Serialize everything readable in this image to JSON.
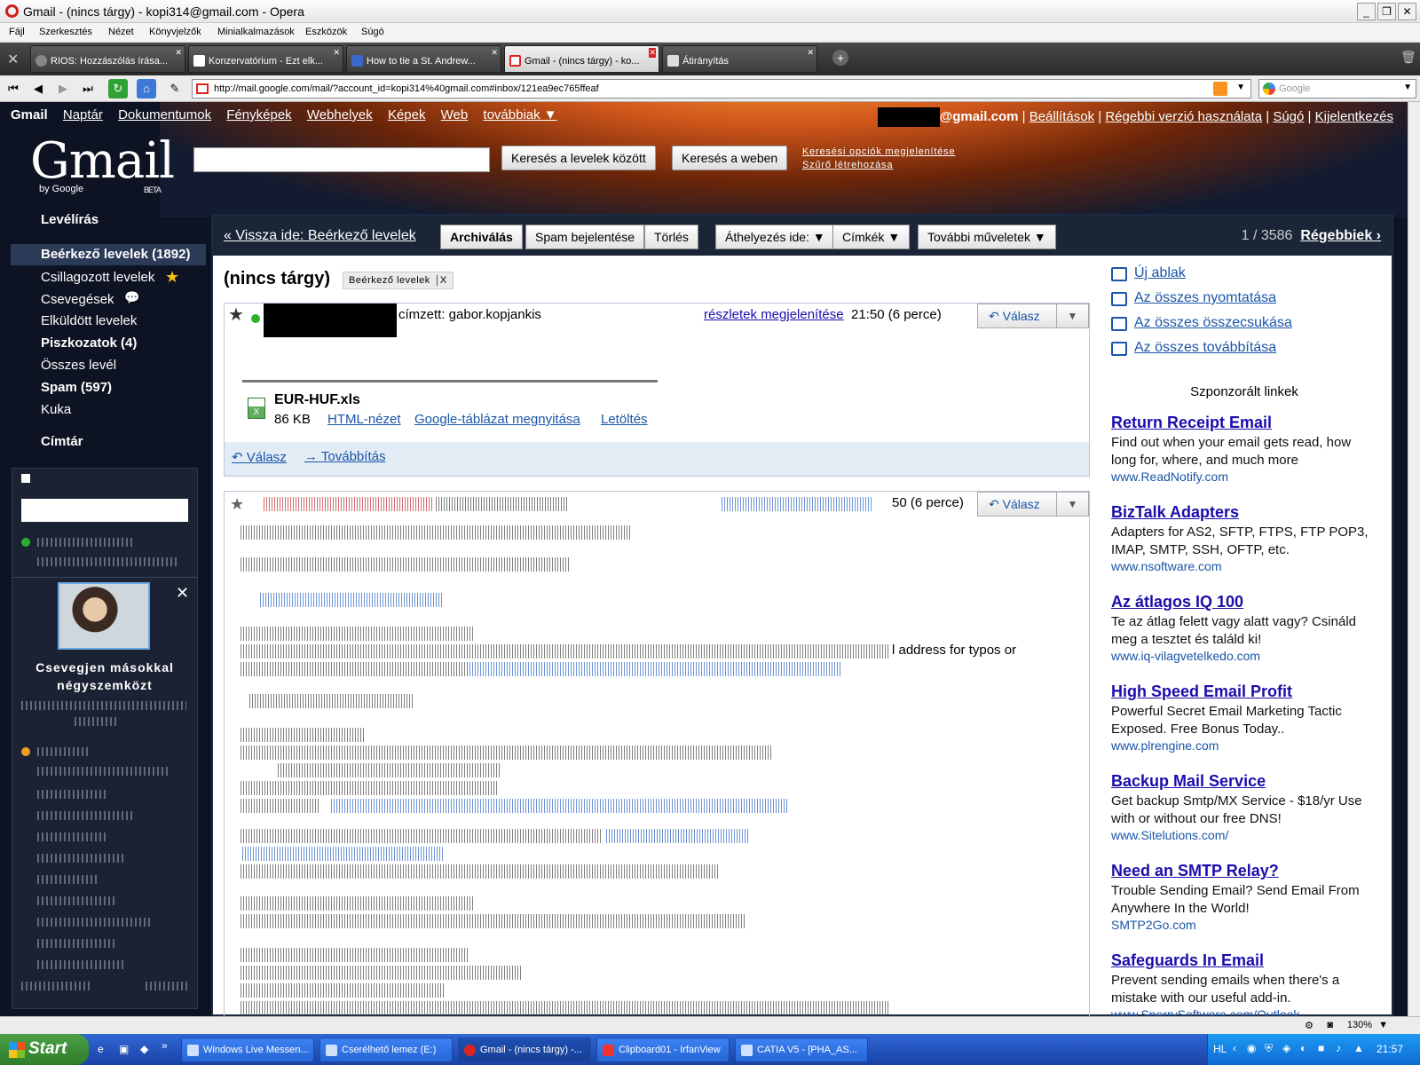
{
  "window": {
    "title": "Gmail - (nincs tárgy) - kopi314@gmail.com - Opera"
  },
  "menu": [
    "Fájl",
    "Szerkesztés",
    "Nézet",
    "Könyvjelzők",
    "Minialkalmazások",
    "Eszközök",
    "Súgó"
  ],
  "tabs": [
    {
      "label": "RIOS: Hozzászólás írása..."
    },
    {
      "label": "Konzervatórium - Ezt elk..."
    },
    {
      "label": "How to tie a St. Andrew..."
    },
    {
      "label": "Gmail - (nincs tárgy) - ko..."
    },
    {
      "label": "Átirányítás"
    }
  ],
  "address": {
    "url": "http://mail.google.com/mail/?account_id=kopi314%40gmail.com#inbox/121ea9ec765ffeaf",
    "search_placeholder": "Google"
  },
  "gmail": {
    "topnav": {
      "brand": "Gmail",
      "links": [
        "Naptár",
        "Dokumentumok",
        "Fényképek",
        "Webhelyek",
        "Képek",
        "Web",
        "továbbiak ▼"
      ]
    },
    "account": {
      "email_suffix": "@gmail.com",
      "links": [
        "Beállítások",
        "Régebbi verzió használata",
        "Súgó",
        "Kijelentkezés"
      ]
    },
    "logo": {
      "text": "Gmail",
      "by": "by Google",
      "beta": "BETA"
    },
    "search": {
      "mail_btn": "Keresés a levelek között",
      "web_btn": "Keresés a weben",
      "options": "Keresési opciók megjelenítése",
      "filter": "Szűrő létrehozása"
    },
    "sidebar": {
      "compose": "Levélírás",
      "items": [
        {
          "label": "Beérkező levelek (1892)"
        },
        {
          "label": "Csillagozott levelek"
        },
        {
          "label": "Csevegések"
        },
        {
          "label": "Elküldött levelek"
        },
        {
          "label": "Piszkozatok (4)"
        },
        {
          "label": "Összes levél"
        },
        {
          "label": "Spam (597)"
        },
        {
          "label": "Kuka"
        }
      ],
      "contacts": "Címtár"
    },
    "chat": {
      "invite": "Csevegjen másokkal négyszemközt"
    },
    "actions": {
      "back": "« Vissza ide: Beérkező levelek",
      "archive": "Archiválás",
      "spam": "Spam bejelentése",
      "delete": "Törlés",
      "move": "Áthelyezés ide: ▼",
      "labels": "Címkék ▼",
      "more": "További műveletek ▼",
      "count": "1 / 3586",
      "older": "Régebbiek ›"
    },
    "thread": {
      "subject": "(nincs tárgy)",
      "label_chip": "Beérkező levelek",
      "label_x": "X"
    },
    "message1": {
      "to": "címzett:  gabor.kopjankis",
      "details": "részletek megjelenítése",
      "time": "21:50 (6 perce)",
      "reply_btn": "Válasz",
      "menu_arrow": "▼",
      "attachment": {
        "name": "EUR-HUF.xls",
        "size": "86 KB",
        "html_view": "HTML-nézet",
        "open_sheet": "Google-táblázat megnyitása",
        "download": "Letöltés"
      },
      "reply": "Válasz",
      "forward": "Továbbítás"
    },
    "message2": {
      "time": "50 (6 perce)",
      "reply_btn": "Válasz",
      "menu_arrow": "▼",
      "visible_text": "l address for typos or"
    },
    "right": {
      "links": [
        "Új ablak",
        "Az összes nyomtatása",
        "Az összes összecsukása",
        "Az összes továbbítása"
      ],
      "sponsored": "Szponzorált linkek",
      "ads": [
        {
          "title": "Return Receipt Email",
          "text": "Find out when your email gets read, how long for, where, and much more",
          "url": "www.ReadNotify.com"
        },
        {
          "title": "BizTalk Adapters",
          "text": "Adapters for AS2, SFTP, FTPS, FTP POP3, IMAP, SMTP, SSH, OFTP, etc.",
          "url": "www.nsoftware.com"
        },
        {
          "title": "Az átlagos IQ 100",
          "text": "Te az átlag felett vagy alatt vagy? Csináld meg a tesztet és találd ki!",
          "url": "www.iq-vilagvetelkedo.com"
        },
        {
          "title": "High Speed Email Profit",
          "text": "Powerful Secret Email Marketing Tactic Exposed. Free Bonus Today..",
          "url": "www.plrengine.com"
        },
        {
          "title": "Backup Mail Service",
          "text": "Get backup Smtp/MX Service - $18/yr Use with or without our free DNS!",
          "url": "www.Sitelutions.com/"
        },
        {
          "title": "Need an SMTP Relay?",
          "text": "Trouble Sending Email? Send Email From Anywhere In the World!",
          "url": "SMTP2Go.com"
        },
        {
          "title": "Safeguards In Email",
          "text": "Prevent sending emails when there's a mistake with our useful add-in.",
          "url": "www.SperrySoftware.com/Outlook"
        }
      ]
    }
  },
  "status": {
    "zoom": "130%"
  },
  "taskbar": {
    "start": "Start",
    "tasks": [
      "Windows Live Messen...",
      "Cserélhető lemez (E:)",
      "Gmail - (nincs tárgy) -...",
      "Clipboard01 - IrfanView",
      "CATIA V5 - [PHA_AS..."
    ],
    "lang": "HL",
    "clock": "21:57"
  },
  "colors": {
    "gmail_bg": "#0d1322",
    "link": "#1a0dab",
    "accent_blue": "#1a55a8",
    "taskbar": "#2766d6"
  }
}
